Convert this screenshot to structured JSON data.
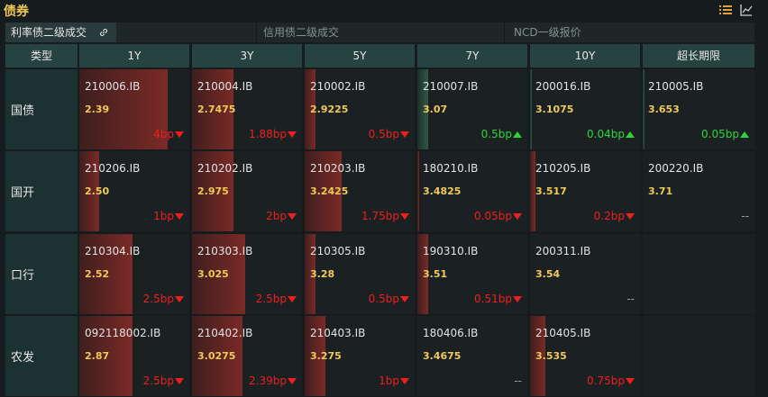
{
  "window": {
    "title": "债券"
  },
  "toolbar": {
    "icons": [
      "list-icon",
      "chart-line-icon"
    ]
  },
  "tabs": [
    {
      "label": "利率债二级成交",
      "active": true,
      "icon": "link-icon"
    },
    {
      "label": "信用债二级成交",
      "active": false
    },
    {
      "label": "NCD一级报价",
      "active": false
    }
  ],
  "table": {
    "type_header": "类型",
    "columns": [
      "1Y",
      "3Y",
      "5Y",
      "7Y",
      "10Y",
      "超长期限"
    ],
    "rows": [
      {
        "label": "国债",
        "cells": [
          {
            "code": "210006.IB",
            "value": "2.39",
            "change": "4bp",
            "dir": "down",
            "bar": 0.8
          },
          {
            "code": "210004.IB",
            "value": "2.7475",
            "change": "1.88bp",
            "dir": "down",
            "bar": 0.38
          },
          {
            "code": "210002.IB",
            "value": "2.9225",
            "change": "0.5bp",
            "dir": "down",
            "bar": 0.1
          },
          {
            "code": "210007.IB",
            "value": "3.07",
            "change": "0.5bp",
            "dir": "up",
            "bar": 0.1
          },
          {
            "code": "200016.IB",
            "value": "3.1075",
            "change": "0.04bp",
            "dir": "up",
            "bar": 0.02
          },
          {
            "code": "210005.IB",
            "value": "3.653",
            "change": "0.05bp",
            "dir": "up",
            "bar": 0.02
          }
        ]
      },
      {
        "label": "国开",
        "cells": [
          {
            "code": "210206.IB",
            "value": "2.50",
            "change": "1bp",
            "dir": "down",
            "bar": 0.18
          },
          {
            "code": "210202.IB",
            "value": "2.975",
            "change": "2bp",
            "dir": "down",
            "bar": 0.38
          },
          {
            "code": "210203.IB",
            "value": "3.2425",
            "change": "1.75bp",
            "dir": "down",
            "bar": 0.34
          },
          {
            "code": "180210.IB",
            "value": "3.4825",
            "change": "0.05bp",
            "dir": "down",
            "bar": 0.02
          },
          {
            "code": "210205.IB",
            "value": "3.517",
            "change": "0.2bp",
            "dir": "down",
            "bar": 0.05
          },
          {
            "code": "200220.IB",
            "value": "3.71",
            "change": "--",
            "dir": "none",
            "bar": 0
          }
        ]
      },
      {
        "label": "口行",
        "cells": [
          {
            "code": "210304.IB",
            "value": "2.52",
            "change": "2.5bp",
            "dir": "down",
            "bar": 0.48
          },
          {
            "code": "210303.IB",
            "value": "3.025",
            "change": "2.5bp",
            "dir": "down",
            "bar": 0.48
          },
          {
            "code": "210305.IB",
            "value": "3.28",
            "change": "0.5bp",
            "dir": "down",
            "bar": 0.1
          },
          {
            "code": "190310.IB",
            "value": "3.51",
            "change": "0.51bp",
            "dir": "down",
            "bar": 0.1
          },
          {
            "code": "200311.IB",
            "value": "3.54",
            "change": "--",
            "dir": "none",
            "bar": 0
          },
          {
            "code": "",
            "value": "",
            "change": "",
            "dir": "none",
            "bar": 0
          }
        ]
      },
      {
        "label": "农发",
        "cells": [
          {
            "code": "092118002.IB",
            "value": "2.87",
            "change": "2.5bp",
            "dir": "down",
            "bar": 0.48
          },
          {
            "code": "210402.IB",
            "value": "3.0275",
            "change": "2.39bp",
            "dir": "down",
            "bar": 0.46
          },
          {
            "code": "210403.IB",
            "value": "3.275",
            "change": "1bp",
            "dir": "down",
            "bar": 0.19
          },
          {
            "code": "180406.IB",
            "value": "3.4675",
            "change": "--",
            "dir": "none",
            "bar": 0
          },
          {
            "code": "210405.IB",
            "value": "3.535",
            "change": "0.75bp",
            "dir": "down",
            "bar": 0.14
          },
          {
            "code": "",
            "value": "",
            "change": "",
            "dir": "none",
            "bar": 0
          }
        ]
      }
    ]
  },
  "colors": {
    "accent": "#f0c95a",
    "down": "#f01e1e",
    "up": "#2ed43c",
    "header_bg": "#27433f",
    "cell_bg": "#1b2123"
  }
}
